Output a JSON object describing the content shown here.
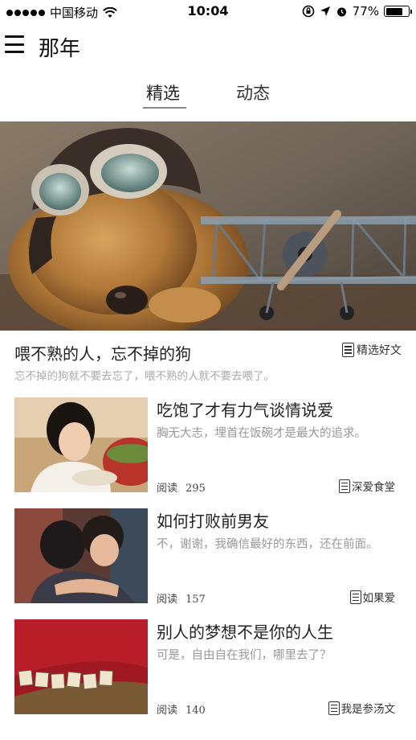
{
  "status_bar": {
    "carrier": "中国移动",
    "time": "10:04",
    "battery": "77%",
    "battery_level": 0.77
  },
  "header": {
    "title": "那年"
  },
  "tabs": [
    {
      "label": "精选",
      "active": true
    },
    {
      "label": "动态",
      "active": false
    }
  ],
  "featured": {
    "title": "喂不熟的人，忘不掉的狗",
    "tag": "精选好文",
    "subtitle": "忘不掉的狗就不要去忘了，喂不熟的人就不要去喂了。"
  },
  "articles": [
    {
      "title": "吃饱了才有力气谈情说爱",
      "desc": "胸无大志，埋首在饭碗才是最大的追求。",
      "read_label": "阅读",
      "reads": "295",
      "tag": "深爱食堂"
    },
    {
      "title": "如何打败前男友",
      "desc": "不，谢谢，我确信最好的东西，还在前面。",
      "read_label": "阅读",
      "reads": "157",
      "tag": "如果爱"
    },
    {
      "title": "别人的梦想不是你的人生",
      "desc": "可是，自由自在我们，哪里去了？",
      "read_label": "阅读",
      "reads": "140",
      "tag": "我是参汤文"
    }
  ],
  "icons": {
    "menu": "menu-icon",
    "doc": "document-icon",
    "wifi": "wifi-icon",
    "location": "location-arrow-icon",
    "alarm": "alarm-icon",
    "lock": "rotation-lock-icon"
  }
}
